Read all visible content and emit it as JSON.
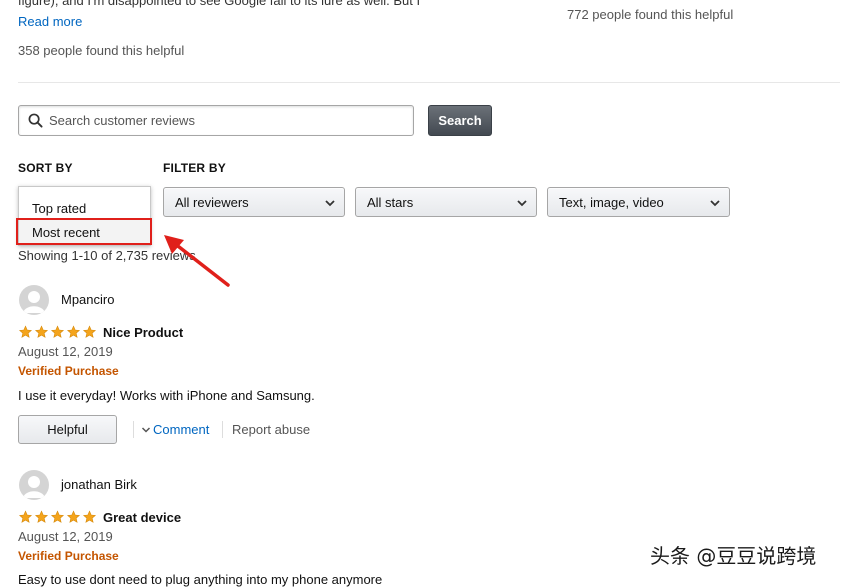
{
  "prev_review": {
    "partial_text": "figure), and I'm disappointed to see Google fall to its lure as well. But I",
    "read_more": "Read more",
    "helpful_count": "358 people found this helpful",
    "right_helpful_count": "772 people found this helpful"
  },
  "search": {
    "placeholder": "Search customer reviews",
    "button_label": "Search"
  },
  "sort": {
    "header": "SORT BY",
    "options": [
      "Top rated",
      "Most recent"
    ],
    "highlighted": "Most recent"
  },
  "filter": {
    "header": "FILTER BY",
    "reviewers": "All reviewers",
    "stars": "All stars",
    "media": "Text, image, video"
  },
  "showing": "Showing 1-10 of 2,735 reviews",
  "reviews": [
    {
      "name": "Mpanciro",
      "rating": 5,
      "title": "Nice Product",
      "date": "August 12, 2019",
      "verified": "Verified Purchase",
      "text": "I use it everyday! Works with iPhone and Samsung.",
      "helpful_label": "Helpful",
      "comment_label": "Comment",
      "report_label": "Report abuse"
    },
    {
      "name": "jonathan Birk",
      "rating": 5,
      "title": "Great device",
      "date": "August 12, 2019",
      "verified": "Verified Purchase",
      "text": "Easy to use dont need to plug anything into my phone anymore"
    }
  ],
  "colors": {
    "star": "#f4a41c",
    "verified": "#c45500",
    "link": "#0066c0",
    "highlight": "#e0201b"
  },
  "watermark": "头条 @豆豆说跨境"
}
